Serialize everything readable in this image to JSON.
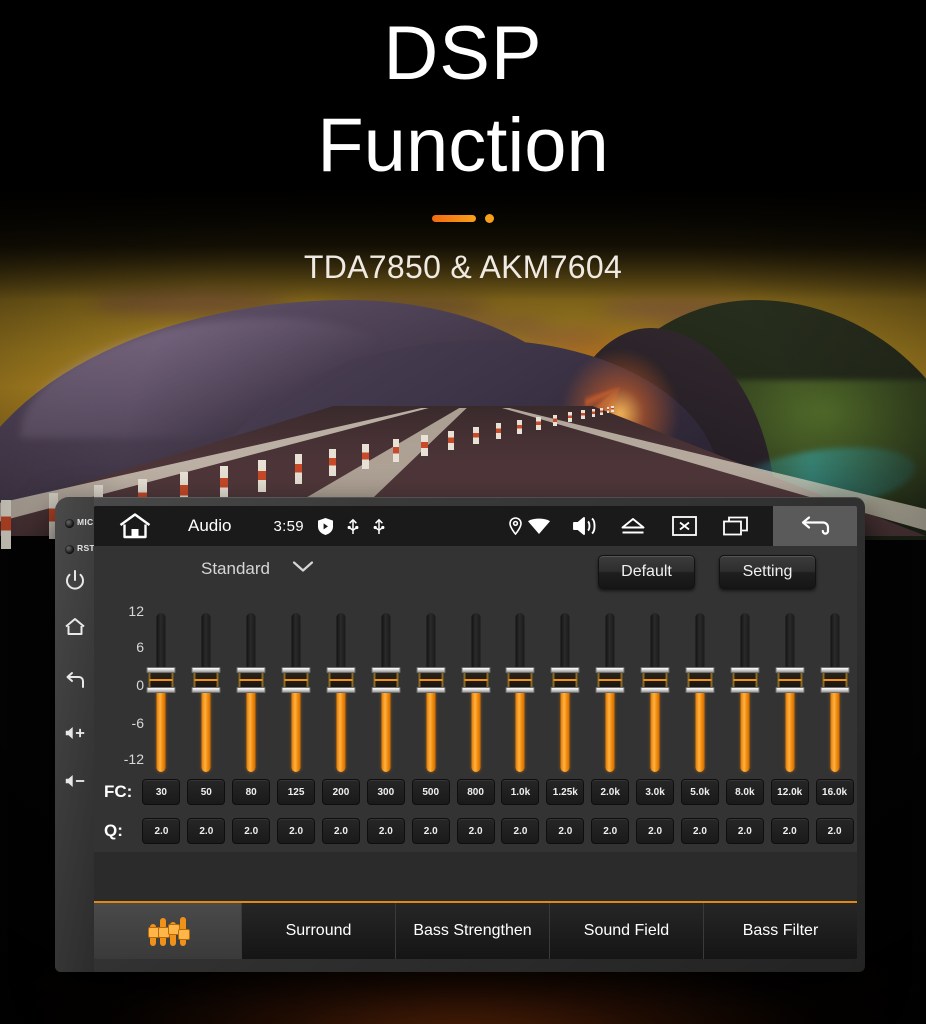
{
  "header": {
    "title_line1": "DSP",
    "title_line2": "Function",
    "subtitle": "TDA7850 & AKM7604"
  },
  "device": {
    "bezel": {
      "mic_label": "MIC",
      "rst_label": "RST",
      "side_buttons": [
        {
          "name": "power-icon"
        },
        {
          "name": "home-icon"
        },
        {
          "name": "back-icon"
        },
        {
          "name": "volume-up-icon"
        },
        {
          "name": "volume-down-icon"
        }
      ]
    },
    "statusbar": {
      "home_icon": "home-icon",
      "title": "Audio",
      "time": "3:59",
      "left_icons": [
        "shield-icon",
        "usb-icon",
        "usb-icon"
      ],
      "right_icons": [
        "location-pin-icon",
        "wifi-icon",
        "speaker-icon",
        "eject-icon",
        "close-box-icon",
        "multi-window-icon"
      ],
      "back_icon": "back-arrow-icon"
    },
    "controls": {
      "preset_value": "Standard",
      "preset_chevron": "chevron-down-icon",
      "default_label": "Default",
      "setting_label": "Setting"
    },
    "equalizer": {
      "axis_labels": [
        "12",
        "6",
        "0",
        "-6",
        "-12"
      ],
      "fc_label": "FC:",
      "q_label": "Q:",
      "bands": [
        {
          "fc": "30",
          "q": "2.0",
          "gain": "0"
        },
        {
          "fc": "50",
          "q": "2.0",
          "gain": "0"
        },
        {
          "fc": "80",
          "q": "2.0",
          "gain": "0"
        },
        {
          "fc": "125",
          "q": "2.0",
          "gain": "0"
        },
        {
          "fc": "200",
          "q": "2.0",
          "gain": "0"
        },
        {
          "fc": "300",
          "q": "2.0",
          "gain": "0"
        },
        {
          "fc": "500",
          "q": "2.0",
          "gain": "0"
        },
        {
          "fc": "800",
          "q": "2.0",
          "gain": "0"
        },
        {
          "fc": "1.0k",
          "q": "2.0",
          "gain": "0"
        },
        {
          "fc": "1.25k",
          "q": "2.0",
          "gain": "0"
        },
        {
          "fc": "2.0k",
          "q": "2.0",
          "gain": "0"
        },
        {
          "fc": "3.0k",
          "q": "2.0",
          "gain": "0"
        },
        {
          "fc": "5.0k",
          "q": "2.0",
          "gain": "0"
        },
        {
          "fc": "8.0k",
          "q": "2.0",
          "gain": "0"
        },
        {
          "fc": "12.0k",
          "q": "2.0",
          "gain": "0"
        },
        {
          "fc": "16.0k",
          "q": "2.0",
          "gain": "0"
        }
      ]
    },
    "tabs": [
      {
        "label": "",
        "icon": "equalizer-icon",
        "active": true
      },
      {
        "label": "Surround",
        "active": false
      },
      {
        "label": "Bass Strengthen",
        "active": false
      },
      {
        "label": "Sound Field",
        "active": false
      },
      {
        "label": "Bass Filter",
        "active": false
      }
    ]
  },
  "colors": {
    "accent_orange": "#f0921a",
    "accent_orange_light": "#ffb142",
    "screen_bg": "#333333",
    "statusbar_bg": "#1a1a1a"
  }
}
